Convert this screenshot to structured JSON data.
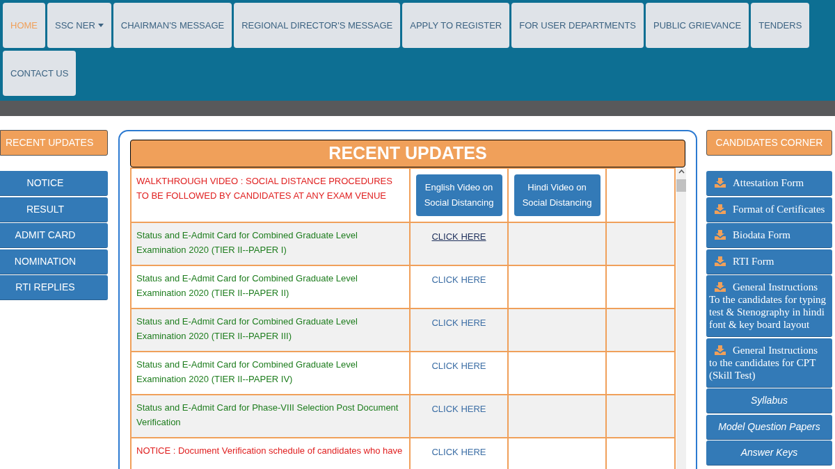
{
  "nav": [
    {
      "label": "HOME",
      "selected": true,
      "has_dropdown": false
    },
    {
      "label": "SSC NER",
      "selected": false,
      "has_dropdown": true
    },
    {
      "label": "CHAIRMAN'S MESSAGE",
      "selected": false,
      "has_dropdown": false
    },
    {
      "label": "REGIONAL DIRECTOR'S MESSAGE",
      "selected": false,
      "has_dropdown": false
    },
    {
      "label": "APPLY TO REGISTER",
      "selected": false,
      "has_dropdown": false
    },
    {
      "label": "FOR USER DEPARTMENTS",
      "selected": false,
      "has_dropdown": false
    },
    {
      "label": "PUBLIC GRIEVANCE",
      "selected": false,
      "has_dropdown": false
    },
    {
      "label": "TENDERS",
      "selected": false,
      "has_dropdown": false
    },
    {
      "label": "CONTACT US",
      "selected": false,
      "has_dropdown": false
    }
  ],
  "left_sidebar": {
    "heading": "RECENT UPDATES",
    "items": [
      "NOTICE",
      "RESULT",
      "ADMIT CARD",
      "NOMINATION",
      "RTI REPLIES"
    ]
  },
  "updates": {
    "title": "RECENT UPDATES",
    "rows": [
      {
        "kind": "alert",
        "text": "WALKTHROUGH VIDEO : SOCIAL DISTANCE PROCEDURES TO BE FOLLOWED BY CANDIDATES AT ANY EXAM VENUE",
        "buttons": [
          "English Video on Social Distancing",
          "Hindi Video on Social Distancing"
        ]
      },
      {
        "kind": "update",
        "text": "Status and E-Admit Card for Combined Graduate Level Examination 2020 (TIER II--PAPER I)",
        "link": "CLICK HERE",
        "hovered": true
      },
      {
        "kind": "update",
        "text": "Status and E-Admit Card for Combined Graduate Level Examination 2020 (TIER II--PAPER II)",
        "link": "CLICK HERE",
        "hovered": false
      },
      {
        "kind": "update",
        "text": "Status and E-Admit Card for Combined Graduate Level Examination 2020 (TIER II--PAPER III)",
        "link": "CLICK HERE",
        "hovered": false
      },
      {
        "kind": "update",
        "text": "Status and E-Admit Card for Combined Graduate Level Examination 2020 (TIER II--PAPER IV)",
        "link": "CLICK HERE",
        "hovered": false
      },
      {
        "kind": "update",
        "text": "Status and E-Admit Card for Phase-VIII Selection Post Document Verification",
        "link": "CLICK HERE",
        "hovered": false
      },
      {
        "kind": "alert",
        "text": "NOTICE : Document Verification schedule of candidates who have",
        "link": "CLICK HERE",
        "hovered": false
      }
    ]
  },
  "right_sidebar": {
    "heading": "CANDIDATES CORNER",
    "items": [
      {
        "kind": "download",
        "title": "Attestation Form"
      },
      {
        "kind": "download",
        "title": "Format of Certificates"
      },
      {
        "kind": "download",
        "title": "Biodata Form"
      },
      {
        "kind": "download",
        "title": "RTI Form"
      },
      {
        "kind": "download",
        "title": "General Instructions",
        "description": "To the candidates for typing test & Stenography in hindi font & key board layout"
      },
      {
        "kind": "download",
        "title": "General Instructions",
        "description": "to the candidates for CPT (Skill Test)"
      },
      {
        "kind": "link",
        "title": "Syllabus"
      },
      {
        "kind": "link",
        "title": "Model Question Papers"
      },
      {
        "kind": "link",
        "title": "Answer Keys"
      }
    ]
  }
}
